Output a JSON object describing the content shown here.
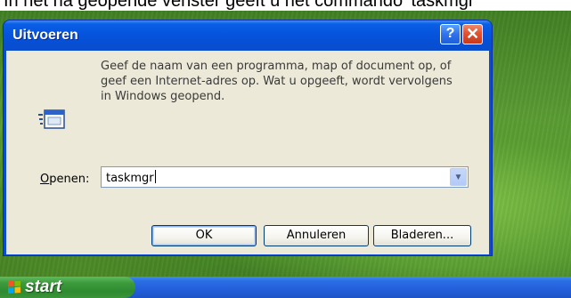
{
  "caption": "In het na geopende venster geeft u het commando 'taskmgr'",
  "dialog": {
    "title": "Uitvoeren",
    "help_button": "?",
    "close_button": "✕",
    "description": "Geef de naam van een programma, map of document op, of geef een Internet-adres op. Wat u opgeeft, wordt vervolgens in Windows geopend.",
    "open_label_accel": "O",
    "open_label_rest": "penen:",
    "open_value": "taskmgr",
    "dropdown_arrow": "▼",
    "ok_label": "OK",
    "cancel_label": "Annuleren",
    "browse_label": "Bladeren..."
  },
  "taskbar": {
    "start_label": "start"
  },
  "colors": {
    "titlebar": "#0654dd",
    "client_bg": "#ece9d8",
    "start_green": "#3c9a3c",
    "taskbar_blue": "#245edb"
  },
  "icons": [
    "run-program-icon",
    "help-icon",
    "close-icon",
    "chevron-down-icon",
    "windows-logo-icon"
  ]
}
